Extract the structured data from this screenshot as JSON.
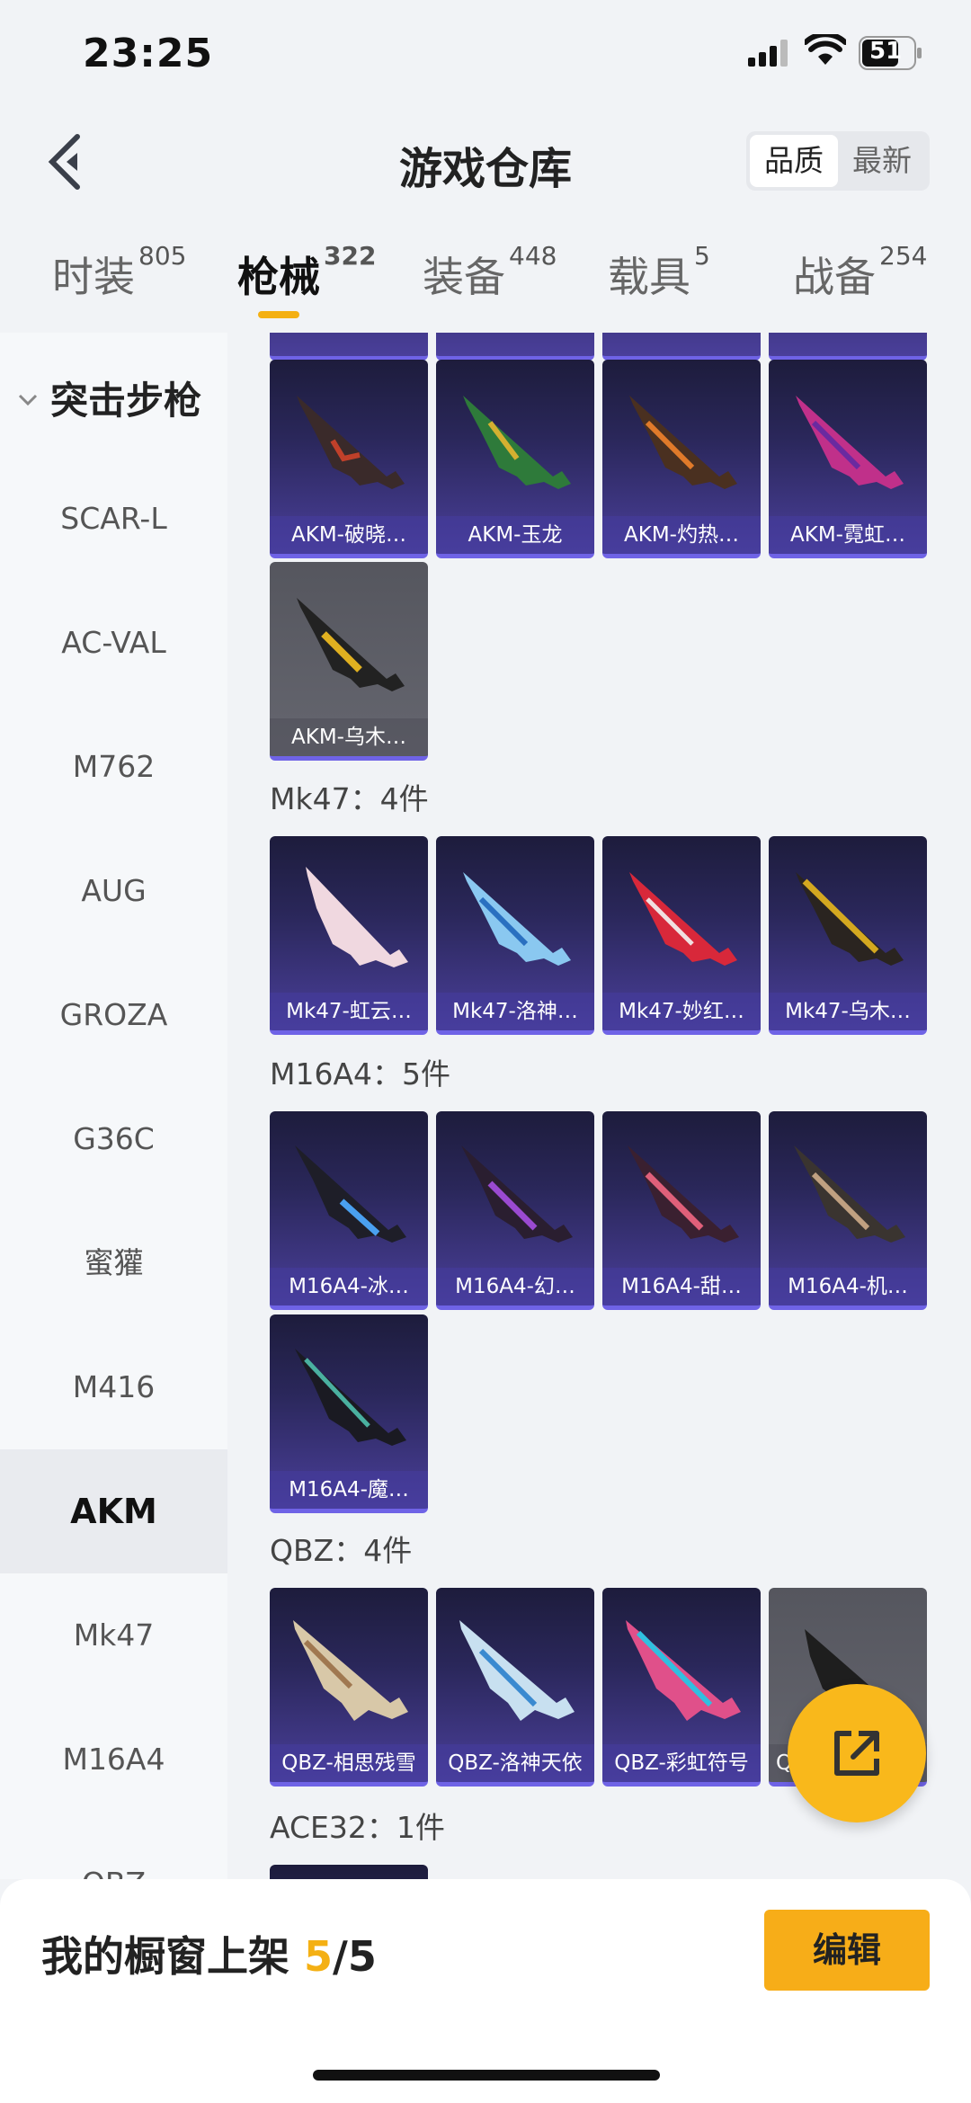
{
  "status": {
    "time": "23:25",
    "battery": "51"
  },
  "header": {
    "title": "游戏仓库",
    "sort_active": "品质",
    "sort_other": "最新"
  },
  "tabs": [
    {
      "label": "时装",
      "count": "805"
    },
    {
      "label": "枪械",
      "count": "322"
    },
    {
      "label": "装备",
      "count": "448"
    },
    {
      "label": "载具",
      "count": "5"
    },
    {
      "label": "战备",
      "count": "254"
    }
  ],
  "sidebar": {
    "category": "突击步枪",
    "items": [
      "SCAR-L",
      "AC-VAL",
      "M762",
      "AUG",
      "GROZA",
      "G36C",
      "蜜獾",
      "M416",
      "AKM",
      "Mk47",
      "M16A4",
      "QBZ"
    ]
  },
  "sections": {
    "akm": {
      "cards": [
        "AKM-破晓…",
        "AKM-玉龙",
        "AKM-灼热…",
        "AKM-霓虹…",
        "AKM-乌木…"
      ]
    },
    "mk47": {
      "title": "Mk47：4件",
      "cards": [
        "Mk47-虹云…",
        "Mk47-洛神…",
        "Mk47-妙红…",
        "Mk47-乌木…"
      ]
    },
    "m16a4": {
      "title": "M16A4：5件",
      "cards": [
        "M16A4-冰…",
        "M16A4-幻…",
        "M16A4-甜…",
        "M16A4-机…",
        "M16A4-魔…"
      ]
    },
    "qbz": {
      "title": "QBZ：4件",
      "cards": [
        "QBZ-相思残雪",
        "QBZ-洛神天依",
        "QBZ-彩虹符号",
        "Q"
      ]
    },
    "ace32": {
      "title": "ACE32：1件"
    }
  },
  "bottom": {
    "label": "我的橱窗上架 ",
    "count": "5",
    "total": "/5",
    "edit": "编辑"
  },
  "colors": {
    "accent": "#f4b014",
    "card_purple": "#4a3f9a"
  }
}
